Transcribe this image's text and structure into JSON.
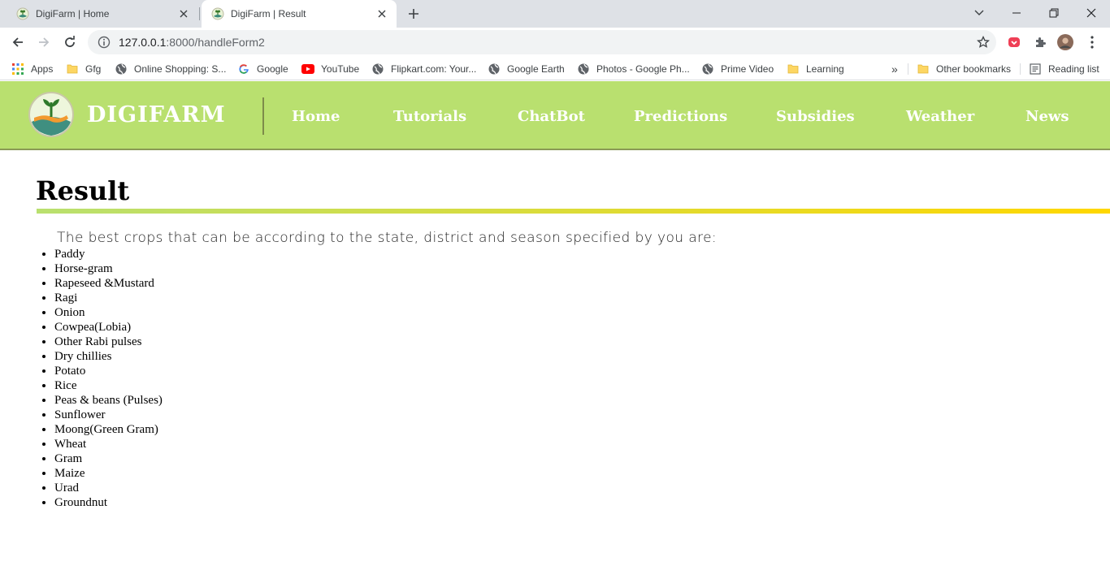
{
  "browser": {
    "tabs": [
      {
        "title": "DigiFarm | Home",
        "active": false
      },
      {
        "title": "DigiFarm | Result",
        "active": true
      }
    ],
    "url_host": "127.0.0.1",
    "url_rest": ":8000/handleForm2",
    "bookmarks": [
      {
        "label": "Apps",
        "icon": "apps-grid-icon"
      },
      {
        "label": "Gfg",
        "icon": "folder-icon"
      },
      {
        "label": "Online Shopping: S...",
        "icon": "globe-icon"
      },
      {
        "label": "Google",
        "icon": "google-icon"
      },
      {
        "label": "YouTube",
        "icon": "youtube-icon"
      },
      {
        "label": "Flipkart.com: Your...",
        "icon": "globe-icon"
      },
      {
        "label": "Google Earth",
        "icon": "globe-icon"
      },
      {
        "label": "Photos - Google Ph...",
        "icon": "globe-icon"
      },
      {
        "label": "Prime Video",
        "icon": "globe-icon"
      },
      {
        "label": "Learning",
        "icon": "folder-icon"
      }
    ],
    "overflow_label": "»",
    "other_bookmarks": "Other bookmarks",
    "reading_list": "Reading list"
  },
  "site": {
    "brand": "DIGIFARM",
    "nav": [
      "Home",
      "Tutorials",
      "ChatBot",
      "Predictions",
      "Subsidies",
      "Weather",
      "News"
    ],
    "colors": {
      "header": "#b9e06f",
      "accent_end": "#ffd700"
    }
  },
  "content": {
    "title": "Result",
    "lead": "The best crops that can be according to the state, district and season specified by you are:",
    "crops": [
      "Paddy",
      "Horse-gram",
      "Rapeseed &Mustard",
      "Ragi",
      "Onion",
      "Cowpea(Lobia)",
      "Other Rabi pulses",
      "Dry chillies",
      "Potato",
      "Rice",
      "Peas & beans (Pulses)",
      "Sunflower",
      "Moong(Green Gram)",
      "Wheat",
      "Gram",
      "Maize",
      "Urad",
      "Groundnut"
    ]
  }
}
